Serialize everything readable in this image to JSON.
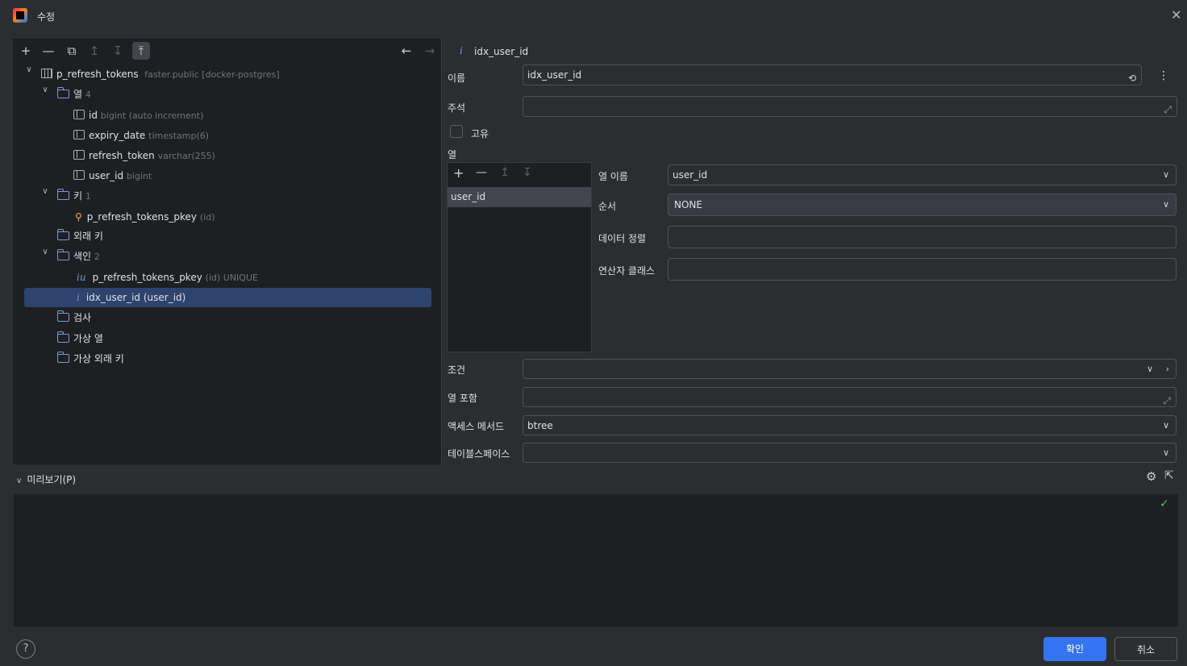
{
  "window": {
    "title": "수정"
  },
  "left_toolbar": {
    "add": "+",
    "remove": "—",
    "copy": "⧉",
    "move_up": "↥",
    "move_down": "↧",
    "pin": "⤒",
    "back": "←",
    "forward": "→"
  },
  "tree": {
    "table_name": "p_refresh_tokens",
    "table_meta": "faster.public [docker-postgres]",
    "columns_folder": "열",
    "columns_count": "4",
    "columns": [
      {
        "name": "id",
        "type": "bigint (auto increment)"
      },
      {
        "name": "expiry_date",
        "type": "timestamp(6)"
      },
      {
        "name": "refresh_token",
        "type": "varchar(255)"
      },
      {
        "name": "user_id",
        "type": "bigint"
      }
    ],
    "keys_folder": "키",
    "keys_count": "1",
    "key_name": "p_refresh_tokens_pkey",
    "key_meta": "(id)",
    "fk_folder": "외래 키",
    "index_folder": "색인",
    "index_count": "2",
    "index1_name": "p_refresh_tokens_pkey",
    "index1_meta": "(id) UNIQUE",
    "index2_name": "idx_user_id (user_id)",
    "check_folder": "검사",
    "virtual_col_folder": "가상 열",
    "virtual_fk_folder": "가상 외래 키"
  },
  "detail": {
    "header": "idx_user_id",
    "name_label": "이름",
    "name_value": "idx_user_id",
    "comment_label": "주석",
    "comment_value": "",
    "unique_label": "고유",
    "columns_label": "열",
    "column_list": [
      "user_id"
    ],
    "col_name_label": "열 이름",
    "col_name_value": "user_id",
    "order_label": "순서",
    "order_value": "NONE",
    "collation_label": "데이터 정렬",
    "collation_value": "",
    "opclass_label": "연산자 클래스",
    "opclass_value": "",
    "condition_label": "조건",
    "condition_value": "",
    "include_label": "열 포함",
    "include_value": "",
    "access_label": "액세스 메서드",
    "access_value": "btree",
    "tablespace_label": "테이블스페이스",
    "tablespace_value": ""
  },
  "preview": {
    "label": "미리보기(P)"
  },
  "buttons": {
    "ok": "확인",
    "cancel": "취소",
    "help": "?"
  }
}
